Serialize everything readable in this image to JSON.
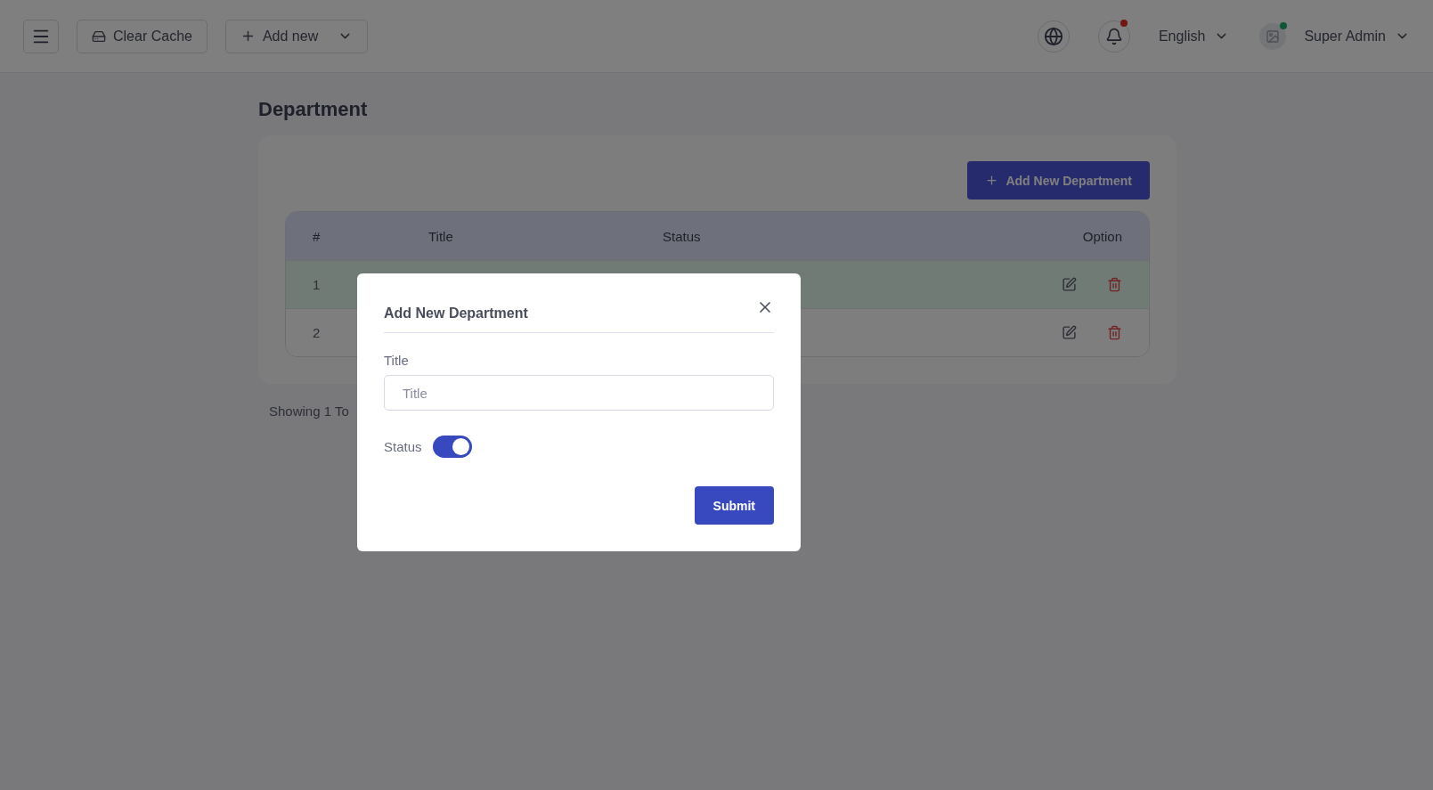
{
  "topbar": {
    "clear_cache": "Clear Cache",
    "add_new": "Add new",
    "language": "English",
    "notifications_unread": true,
    "user": {
      "name": "Super Admin",
      "online": true
    }
  },
  "page": {
    "title": "Department",
    "add_button": "Add New Department",
    "table": {
      "columns": [
        "#",
        "Title",
        "Status",
        "Option"
      ],
      "rows": [
        {
          "index": "1",
          "selected": true
        },
        {
          "index": "2",
          "selected": false
        }
      ]
    },
    "footer": "Showing 1 To"
  },
  "modal": {
    "title": "Add New Department",
    "title_label": "Title",
    "title_placeholder": "Title",
    "status_label": "Status",
    "status_on": true,
    "submit": "Submit"
  }
}
